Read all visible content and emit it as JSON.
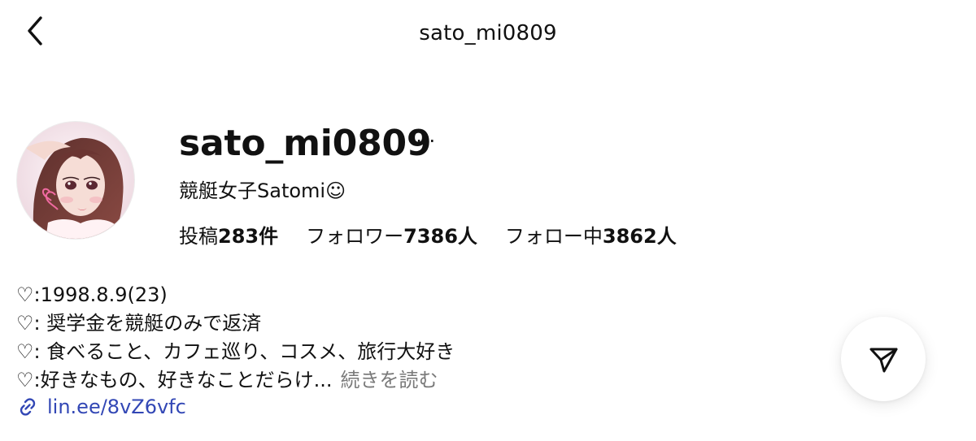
{
  "header": {
    "title": "sato_mi0809"
  },
  "profile": {
    "username": "sato_mi0809",
    "display_name": "競艇女子Satomi☺",
    "stats": [
      {
        "label": "投稿",
        "value": "283件"
      },
      {
        "label": "フォロワー",
        "value": "7386人"
      },
      {
        "label": "フォロー中",
        "value": "3862人"
      }
    ],
    "bio_lines": [
      "♡:1998.8.9(23)",
      "♡: 奨学金を競艇のみで返済",
      "♡: 食べること、カフェ巡り、コスメ、旅行大好き",
      "♡:好きなもの、好きなことだらけ..."
    ],
    "more_label": "続きを読む",
    "link_text": "lin.ee/8vZ6vfc"
  },
  "icons": {
    "back": "back-arrow-icon",
    "more": "more-horizontal-icon",
    "link": "link-icon",
    "send": "paper-plane-icon"
  },
  "colors": {
    "link_blue": "#3247b5",
    "muted_gray": "#7a7a7a"
  }
}
